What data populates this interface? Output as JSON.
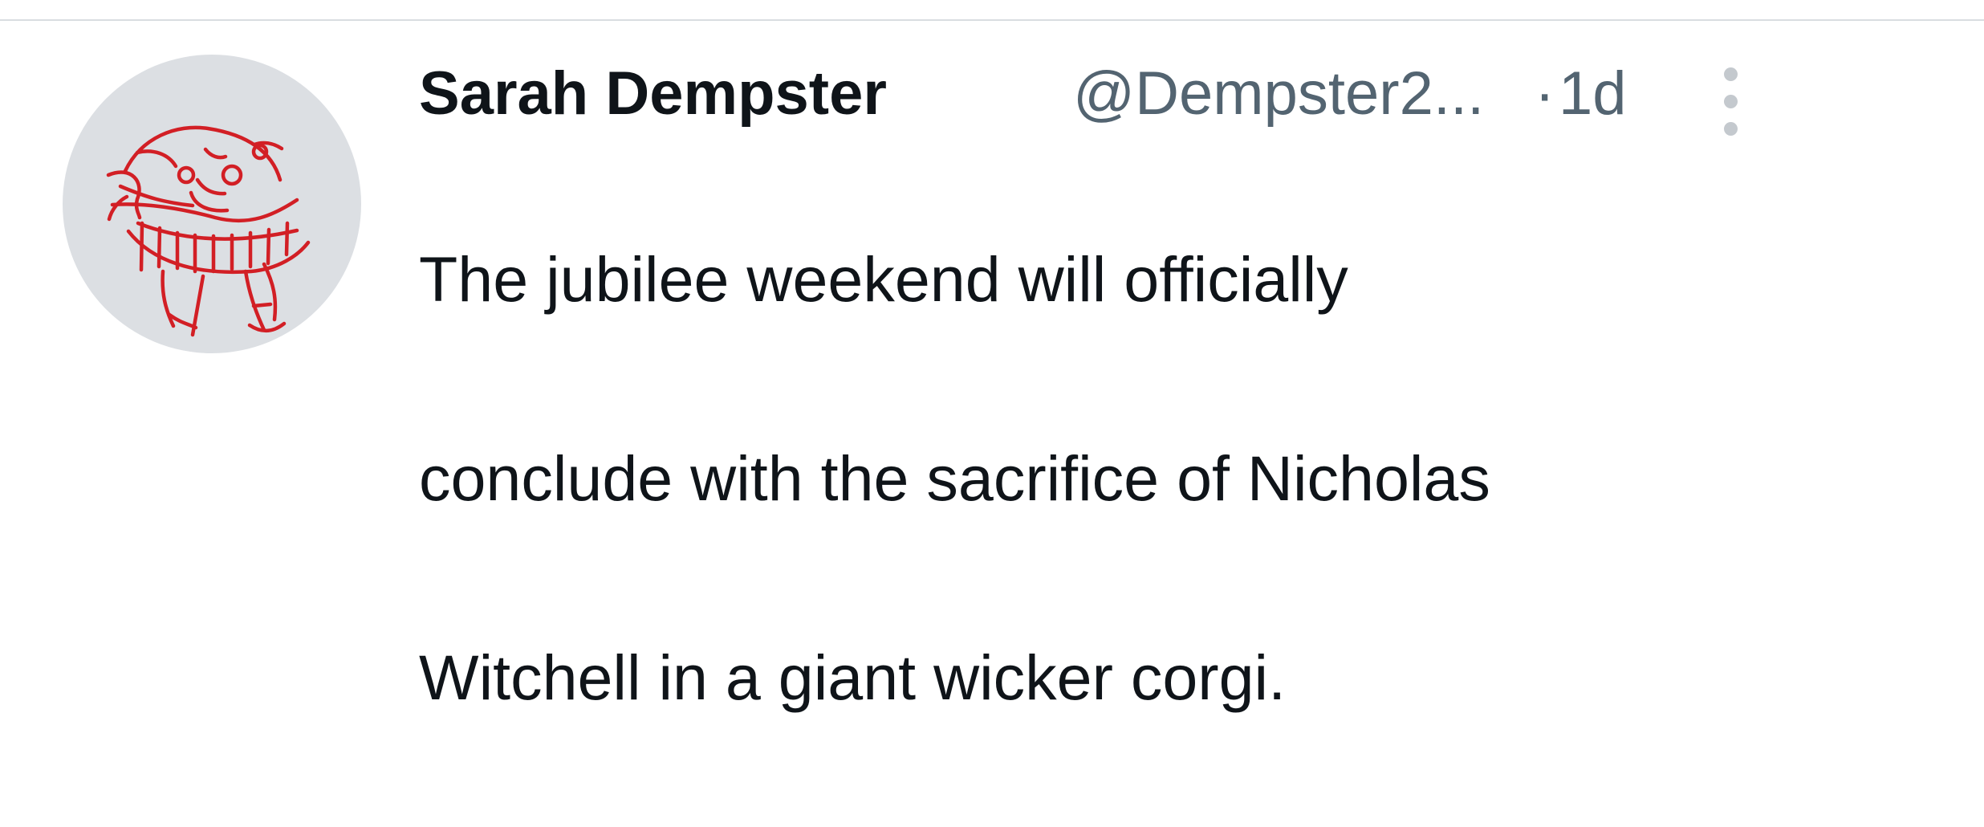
{
  "tweet": {
    "author": {
      "display_name": "Sarah Dempster",
      "handle": "@Dempster2..."
    },
    "separator": "·",
    "timestamp": "1d",
    "text_lines": [
      "The jubilee weekend will officially",
      "conclude with the sacrifice of Nicholas",
      "Witchell in a giant wicker corgi."
    ],
    "icons": {
      "avatar": "hand-drawn-red-doodle-avatar",
      "more": "more-vertical-icon"
    }
  },
  "colors": {
    "text_primary": "#0f1419",
    "text_secondary": "#536471",
    "divider": "#d9dde1",
    "avatar_background": "#dcdfe3",
    "avatar_doodle": "#d21f25"
  }
}
